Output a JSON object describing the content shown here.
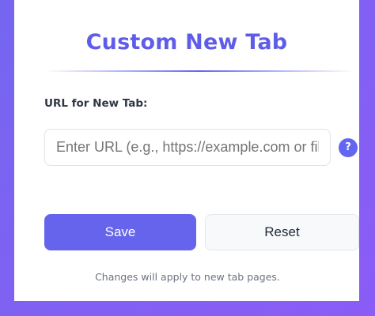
{
  "header": {
    "title": "Custom New Tab"
  },
  "form": {
    "url_label": "URL for New Tab:",
    "url_placeholder": "Enter URL (e.g., https://example.com or file",
    "url_value": "",
    "help_icon_glyph": "?",
    "help_icon": "question-mark-icon"
  },
  "actions": {
    "save_label": "Save",
    "reset_label": "Reset"
  },
  "footer": {
    "note": "Changes will apply to new tab pages."
  },
  "colors": {
    "background": "#7b5cf3",
    "accent": "#6366f1",
    "save_button": "#6664ec",
    "card": "#ffffff"
  }
}
